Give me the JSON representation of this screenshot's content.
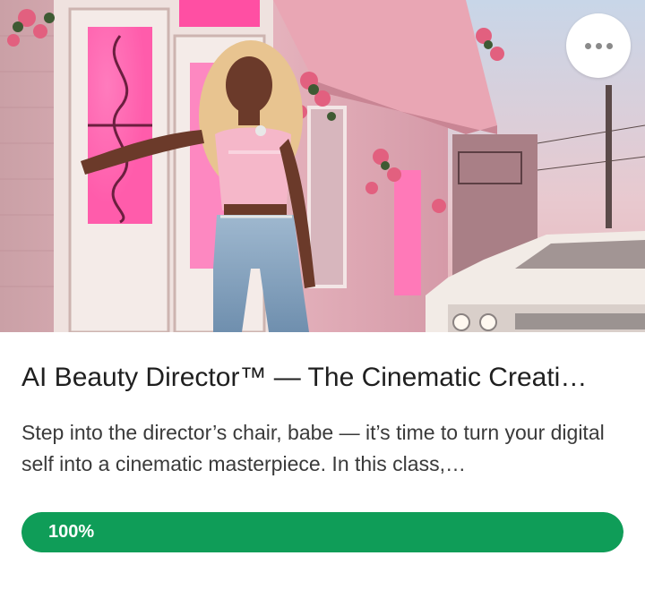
{
  "course": {
    "image_alt": "Woman in pink corset and ripped jeans posing by a pink-lit doorway with flowers and a white vintage car",
    "menu_icon": "more-horizontal-icon",
    "title": "AI Beauty Director™ — The Cinematic Creati…",
    "description": "Step into the director’s chair, babe — it’s time to turn your digital self into a cinematic masterpiece. In this class,…",
    "progress": {
      "value": 100,
      "label": "100%",
      "color": "#0f9d58"
    }
  }
}
